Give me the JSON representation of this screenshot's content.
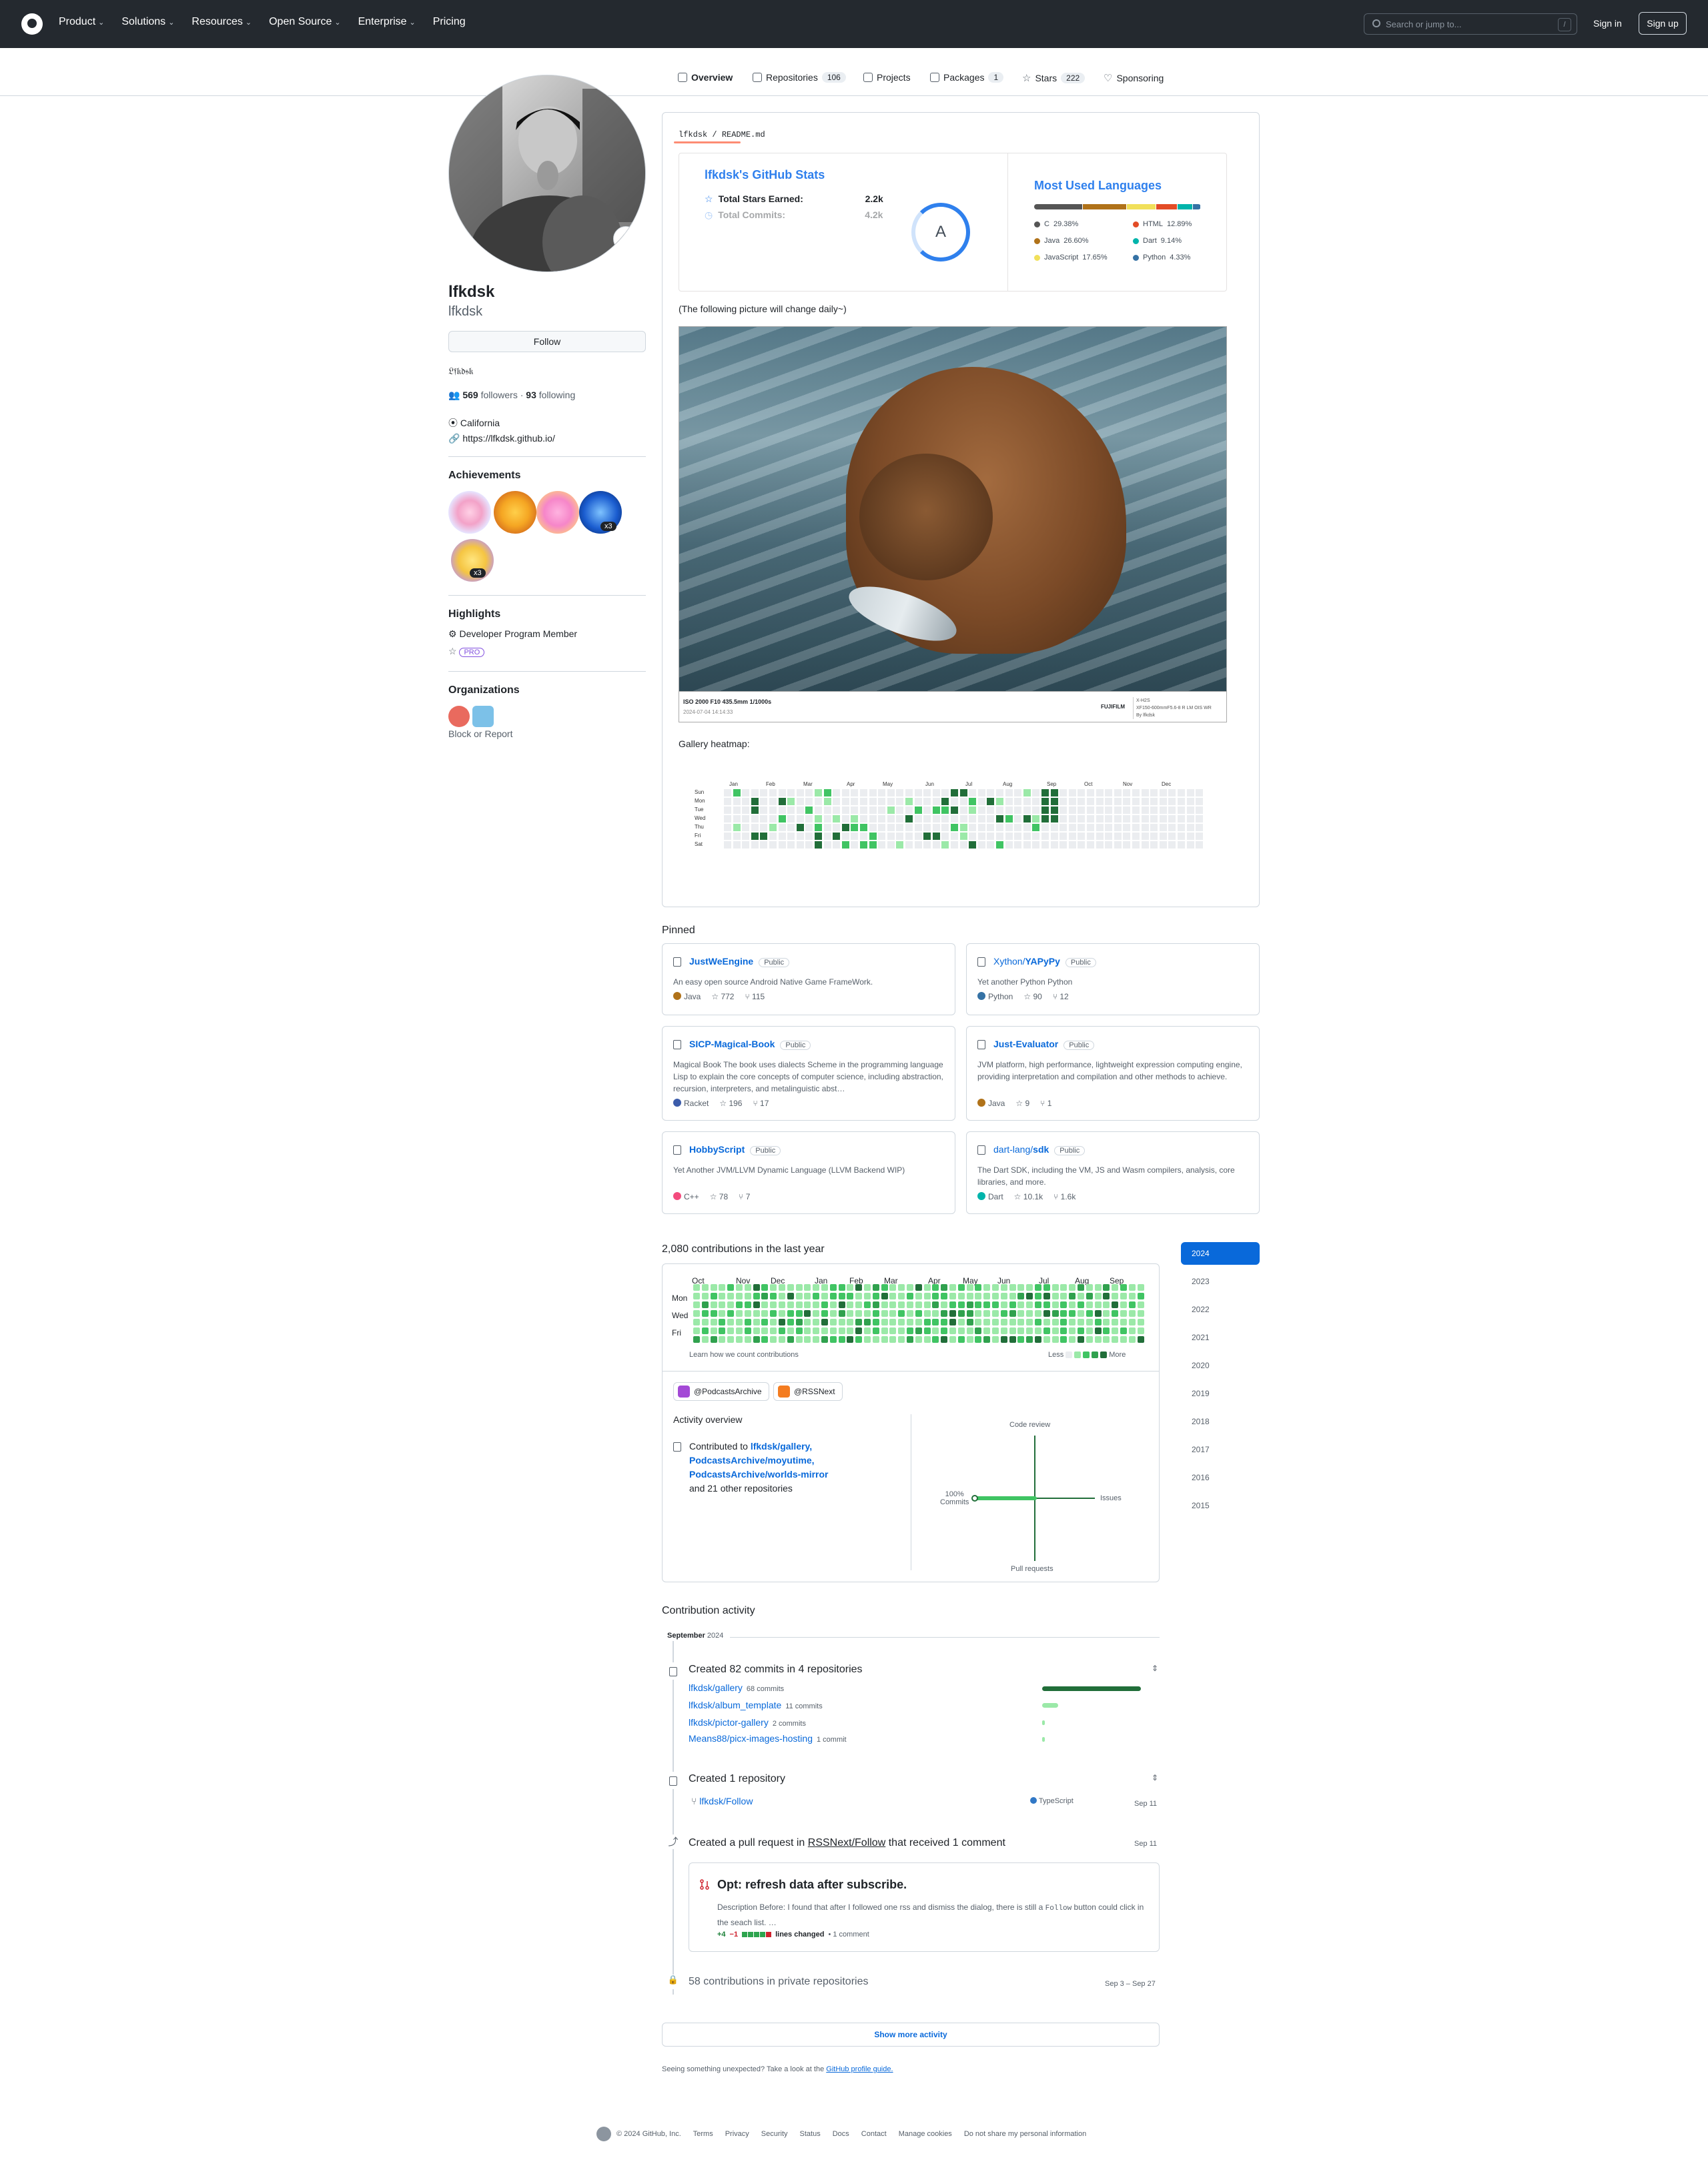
{
  "header": {
    "nav": [
      {
        "label": "Product",
        "dropdown": true
      },
      {
        "label": "Solutions",
        "dropdown": true
      },
      {
        "label": "Resources",
        "dropdown": true
      },
      {
        "label": "Open Source",
        "dropdown": true
      },
      {
        "label": "Enterprise",
        "dropdown": true
      },
      {
        "label": "Pricing",
        "dropdown": false
      }
    ],
    "search_placeholder": "Search or jump to...",
    "search_shortcut": "/",
    "signin": "Sign in",
    "signup": "Sign up"
  },
  "tabs": [
    {
      "label": "Overview",
      "count": "",
      "selected": true
    },
    {
      "label": "Repositories",
      "count": "106"
    },
    {
      "label": "Projects",
      "count": ""
    },
    {
      "label": "Packages",
      "count": "1"
    },
    {
      "label": "Stars",
      "count": "222"
    },
    {
      "label": "Sponsoring",
      "count": ""
    }
  ],
  "profile": {
    "name": "lfkdsk",
    "login": "lfkdsk",
    "follow": "Follow",
    "bio": "𝔏𝔣𝔨𝔡𝔰𝔨",
    "followers": "569",
    "followers_label": "followers",
    "sep": "·",
    "following": "93",
    "following_label": "following",
    "location": "California",
    "website": "https://lfkdsk.github.io/"
  },
  "achievements": {
    "title": "Achievements",
    "counts": [
      "x3",
      "x3"
    ]
  },
  "highlights": {
    "title": "Highlights",
    "items": [
      "Developer Program Member"
    ],
    "pro": "PRO"
  },
  "organizations": {
    "title": "Organizations",
    "block": "Block or Report"
  },
  "readme": {
    "path_owner": "lfkdsk",
    "path_sep": "/",
    "path_file": "README.md",
    "stats": {
      "title": "lfkdsk's GitHub Stats",
      "rows": [
        {
          "label": "Total Stars Earned:",
          "value": "2.2k"
        },
        {
          "label": "Total Commits:",
          "value": "4.2k"
        }
      ],
      "grade": "A",
      "lang_title": "Most Used Languages",
      "languages": [
        {
          "name": "C",
          "pct": "29.38%",
          "value": 29.38,
          "color": "#555555"
        },
        {
          "name": "HTML",
          "pct": "12.89%",
          "value": 12.89,
          "color": "#e34c26"
        },
        {
          "name": "Java",
          "pct": "26.60%",
          "value": 26.6,
          "color": "#b07219"
        },
        {
          "name": "Dart",
          "pct": "9.14%",
          "value": 9.14,
          "color": "#00b4ab"
        },
        {
          "name": "JavaScript",
          "pct": "17.65%",
          "value": 17.65,
          "color": "#f1e05a"
        },
        {
          "name": "Python",
          "pct": "4.33%",
          "value": 4.33,
          "color": "#3572a5"
        }
      ]
    },
    "note": "(The following picture will change daily~)",
    "photo_caption": {
      "exif": "ISO 2000 F10 435.5mm 1/1000s",
      "date": "2024-07-04 14:14:33",
      "brand": "FUJIFILM",
      "model": "X-H2S",
      "lens": "XF150-600mmF5.6-8 R LM OIS WR",
      "by": "By lfkdsk"
    },
    "heatmap_label": "Gallery heatmap:",
    "heatmap": {
      "months": [
        "Jan",
        "Feb",
        "Mar",
        "Apr",
        "May",
        "Jun",
        "Jul",
        "Aug",
        "Sep",
        "Oct",
        "Nov",
        "Dec"
      ],
      "days": [
        "Sun",
        "Mon",
        "Tue",
        "Wed",
        "Thu",
        "Fri",
        "Sat"
      ]
    }
  },
  "pinned": {
    "title": "Pinned",
    "repos": [
      {
        "owner": "",
        "name": "JustWeEngine",
        "badge": "Public",
        "desc": "An easy open source Android Native Game FrameWork.",
        "lang": "Java",
        "color": "#b07219",
        "stars": "772",
        "forks": "115"
      },
      {
        "owner": "Xython/",
        "name": "YAPyPy",
        "badge": "Public",
        "desc": "Yet another Python Python",
        "lang": "Python",
        "color": "#3572a5",
        "stars": "90",
        "forks": "12"
      },
      {
        "owner": "",
        "name": "SICP-Magical-Book",
        "badge": "Public",
        "desc": "Magical Book The book uses dialects Scheme in the programming language Lisp to explain the core concepts of computer science, including abstraction, recursion, interpreters, and metalinguistic abst…",
        "lang": "Racket",
        "color": "#3c5caa",
        "stars": "196",
        "forks": "17"
      },
      {
        "owner": "",
        "name": "Just-Evaluator",
        "badge": "Public",
        "desc": "JVM platform, high performance, lightweight expression computing engine, providing interpretation and compilation and other methods to achieve.",
        "lang": "Java",
        "color": "#b07219",
        "stars": "9",
        "forks": "1"
      },
      {
        "owner": "",
        "name": "HobbyScript",
        "badge": "Public",
        "desc": "Yet Another JVM/LLVM Dynamic Language (LLVM Backend WIP)",
        "lang": "C++",
        "color": "#f34b7d",
        "stars": "78",
        "forks": "7"
      },
      {
        "owner": "dart-lang/",
        "name": "sdk",
        "badge": "Public",
        "desc": "The Dart SDK, including the VM, JS and Wasm compilers, analysis, core libraries, and more.",
        "lang": "Dart",
        "color": "#00b4ab",
        "stars": "10.1k",
        "forks": "1.6k"
      }
    ]
  },
  "contributions": {
    "title": "2,080 contributions in the last year",
    "years": [
      "2024",
      "2023",
      "2022",
      "2021",
      "2020",
      "2019",
      "2018",
      "2017",
      "2016",
      "2015"
    ],
    "months": [
      "Oct",
      "Nov",
      "Dec",
      "Jan",
      "Feb",
      "Mar",
      "Apr",
      "May",
      "Jun",
      "Jul",
      "Aug",
      "Sep"
    ],
    "days": [
      "Mon",
      "Wed",
      "Fri"
    ],
    "learn": "Learn how we count contributions",
    "less": "Less",
    "more": "More",
    "colors": [
      "#ebedf0",
      "#9be9a8",
      "#40c463",
      "#30a14e",
      "#216e39"
    ]
  },
  "activity_overview": {
    "orgs": [
      "@PodcastsArchive",
      "@RSSNext"
    ],
    "title": "Activity overview",
    "contributed_to": "Contributed to",
    "repos": [
      "lfkdsk/gallery,",
      "PodcastsArchive/moyutime,",
      "PodcastsArchive/worlds-mirror"
    ],
    "others": "and 21 other repositories",
    "axes": {
      "top": "Code review",
      "right": "Issues",
      "bottom": "Pull requests",
      "left_pct": "100%",
      "left": "Commits"
    },
    "commits_pct": 100
  },
  "activity": {
    "title": "Contribution activity",
    "month": "September",
    "year": "2024",
    "commits": {
      "title": "Created 82 commits in 4 repositories",
      "repos": [
        {
          "name": "lfkdsk/gallery",
          "count": "68 commits",
          "value": 68
        },
        {
          "name": "lfkdsk/album_template",
          "count": "11 commits",
          "value": 11
        },
        {
          "name": "lfkdsk/pictor-gallery",
          "count": "2 commits",
          "value": 2
        },
        {
          "name": "Means88/picx-images-hosting",
          "count": "1 commit",
          "value": 1
        }
      ]
    },
    "created_repo": {
      "title": "Created 1 repository",
      "repo": "lfkdsk/Follow",
      "lang": "TypeScript",
      "date": "Sep 11"
    },
    "pull_request": {
      "title_pre": "Created a pull request in",
      "repo": "RSSNext/Follow",
      "title_post": "that received 1 comment",
      "date": "Sep 11",
      "pr_title": "Opt: refresh data after subscribe.",
      "body_pre": "Description Before: I found that after I followed one rss and dismiss the dialog, there is still a",
      "body_code": "Follow",
      "body_post": "button could click in the seach list. …",
      "additions": "+4",
      "deletions": "−1",
      "lines": "lines changed",
      "comments": "• 1 comment"
    },
    "private": {
      "title": "58 contributions in private repositories",
      "dates": "Sep 3 – Sep 27"
    },
    "show_more": "Show more activity",
    "unexpected": "Seeing something unexpected? Take a look at the",
    "guide": "GitHub profile guide."
  },
  "footer": [
    "© 2024 GitHub, Inc.",
    "Terms",
    "Privacy",
    "Security",
    "Status",
    "Docs",
    "Contact",
    "Manage cookies",
    "Do not share my personal information"
  ]
}
